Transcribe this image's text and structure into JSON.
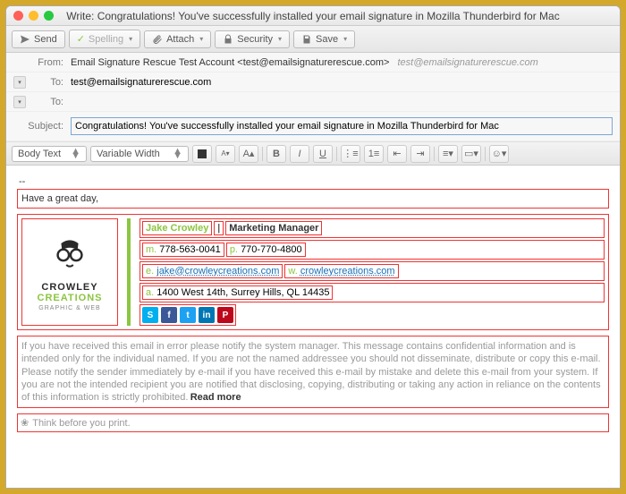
{
  "window": {
    "title": "Write: Congratulations! You've successfully installed your email signature in Mozilla Thunderbird for Mac"
  },
  "toolbar": {
    "send": "Send",
    "spelling": "Spelling",
    "attach": "Attach",
    "security": "Security",
    "save": "Save"
  },
  "headers": {
    "from_label": "From:",
    "from_name": "Email Signature Rescue Test Account <test@emailsignaturerescue.com>",
    "identity": "test@emailsignaturerescue.com",
    "to_label": "To:",
    "to_value": "test@emailsignaturerescue.com",
    "to2_label": "To:",
    "subject_label": "Subject:",
    "subject_value": "Congratulations! You've successfully installed your email signature in Mozilla Thunderbird for Mac"
  },
  "format": {
    "para": "Body Text",
    "font": "Variable Width"
  },
  "body": {
    "dashes": "--",
    "greeting": "Have a great day,",
    "sig": {
      "brand1": "CROWLEY",
      "brand2": "CREATIONS",
      "tagline": "GRAPHIC & WEB",
      "name": "Jake Crowley",
      "title": "Marketing Manager",
      "m_lbl": "m.",
      "m": "778-563-0041",
      "p_lbl": "p.",
      "p": "770-770-4800",
      "e_lbl": "e.",
      "e": "jake@crowleycreations.com",
      "w_lbl": "w.",
      "w": "crowleycreations.com",
      "a_lbl": "a.",
      "a": "1400 West 14th, Surrey Hills, QL 14435"
    },
    "disclaimer": "If you have received this email in error please notify the system manager. This message contains confidential information and is intended only for the individual named. If you are not the named addressee you should not disseminate, distribute or copy this e-mail. Please notify the sender immediately by e-mail if you have received this e-mail by mistake and delete this e-mail from your system. If you are not the intended recipient you are notified that disclosing, copying, distributing or taking any action in reliance on the contents of this information is strictly prohibited.",
    "readmore": "Read more",
    "think": "Think before you print."
  }
}
